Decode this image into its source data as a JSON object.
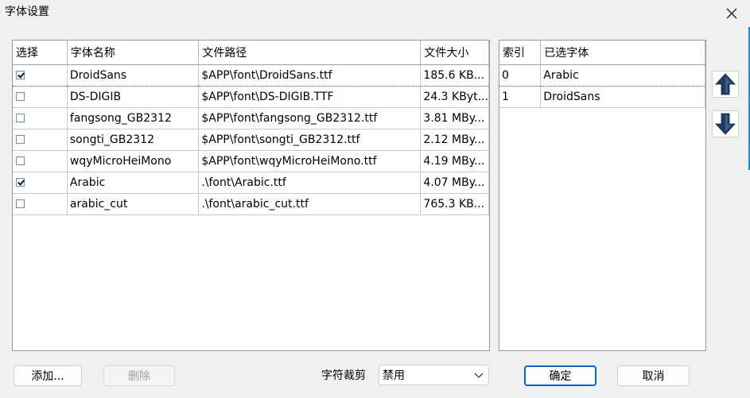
{
  "window": {
    "title": "字体设置"
  },
  "font_table": {
    "columns": [
      "选择",
      "字体名称",
      "文件路径",
      "文件大小"
    ],
    "rows": [
      {
        "checked": true,
        "name": "DroidSans",
        "path": "$APP\\font\\DroidSans.ttf",
        "size": "185.6 KB..."
      },
      {
        "checked": false,
        "name": "DS-DIGIB",
        "path": "$APP\\font\\DS-DIGIB.TTF",
        "size": "24.3 KByt..."
      },
      {
        "checked": false,
        "name": "fangsong_GB2312",
        "path": "$APP\\font\\fangsong_GB2312.ttf",
        "size": "3.81 MBy..."
      },
      {
        "checked": false,
        "name": "songti_GB2312",
        "path": "$APP\\font\\songti_GB2312.ttf",
        "size": "2.12 MBy..."
      },
      {
        "checked": false,
        "name": "wqyMicroHeiMono",
        "path": "$APP\\font\\wqyMicroHeiMono.ttf",
        "size": "4.19 MBy..."
      },
      {
        "checked": true,
        "name": "Arabic",
        "path": ".\\font\\Arabic.ttf",
        "size": "4.07 MBy..."
      },
      {
        "checked": false,
        "name": "arabic_cut",
        "path": ".\\font\\arabic_cut.ttf",
        "size": "765.3 KB..."
      }
    ]
  },
  "selected_table": {
    "columns": [
      "索引",
      "已选字体"
    ],
    "rows": [
      {
        "index": "0",
        "font": "Arabic"
      },
      {
        "index": "1",
        "font": "DroidSans"
      }
    ]
  },
  "buttons": {
    "add": "添加...",
    "delete": "删除",
    "ok": "确定",
    "cancel": "取消"
  },
  "clip": {
    "label": "字符裁剪",
    "value": "禁用"
  },
  "icons": {
    "move_up": "arrow-up-icon",
    "move_down": "arrow-down-icon",
    "close": "close-icon"
  },
  "colors": {
    "arrow": "#1f3d63",
    "accent": "#0a64c8"
  }
}
